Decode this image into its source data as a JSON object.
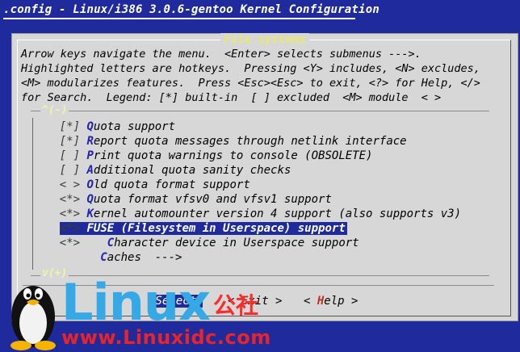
{
  "window": {
    "title": ".config - Linux/i386 3.0.6-gentoo Kernel Configuration"
  },
  "dialog": {
    "title": "File systems",
    "help_lines": [
      "Arrow keys navigate the menu.  <Enter> selects submenus --->.",
      "Highlighted letters are hotkeys.  Pressing <Y> includes, <N> excludes,",
      "<M> modularizes features.  Press <Esc><Esc> to exit, <?> for Help, </>",
      "for Search.  Legend: [*] built-in  [ ] excluded  <M> module  < >"
    ],
    "scroll_up_marker": "^(-)",
    "scroll_down_marker": "v(+)",
    "menu_items": [
      {
        "state": "[*]",
        "hotkey": "Q",
        "rest": "uota support"
      },
      {
        "state": "[*]",
        "hotkey": "R",
        "rest": "eport quota messages through netlink interface"
      },
      {
        "state": "[ ]",
        "hotkey": "P",
        "rest": "rint quota warnings to console (OBSOLETE)"
      },
      {
        "state": "[ ]",
        "hotkey": "A",
        "rest": "dditional quota sanity checks"
      },
      {
        "state": "< >",
        "hotkey": "O",
        "rest": "ld quota format support"
      },
      {
        "state": "<*>",
        "hotkey": "Q",
        "rest": "uota format vfsv0 and vfsv1 support"
      },
      {
        "state": "<*>",
        "hotkey": "K",
        "rest": "ernel automounter version 4 support (also supports v3)"
      },
      {
        "state": "<*>",
        "hotkey": "F",
        "rest": "USE (Filesystem in Userspace) support"
      },
      {
        "state": "<*>",
        "hotkey": "C",
        "rest": "haracter device in Userspace support"
      },
      {
        "state": "",
        "hotkey": "C",
        "rest": "aches  --->"
      }
    ],
    "buttons": {
      "select": "<Select>",
      "exit_prefix": "< ",
      "exit_hot": "E",
      "exit_rest": "xit >",
      "help_prefix": "< ",
      "help_hot": "H",
      "help_rest": "elp >"
    }
  },
  "watermark": {
    "brand": "Linux",
    "cn": "公社",
    "url": "www.Linuxidc.com"
  },
  "colors": {
    "background": "#1f2b9c",
    "dialog": "#d7d7d7",
    "hotkey": "#2222bb",
    "highlight": "#1f2b9c",
    "brand_blue": "#35a9e6",
    "brand_red": "#e8242a"
  }
}
